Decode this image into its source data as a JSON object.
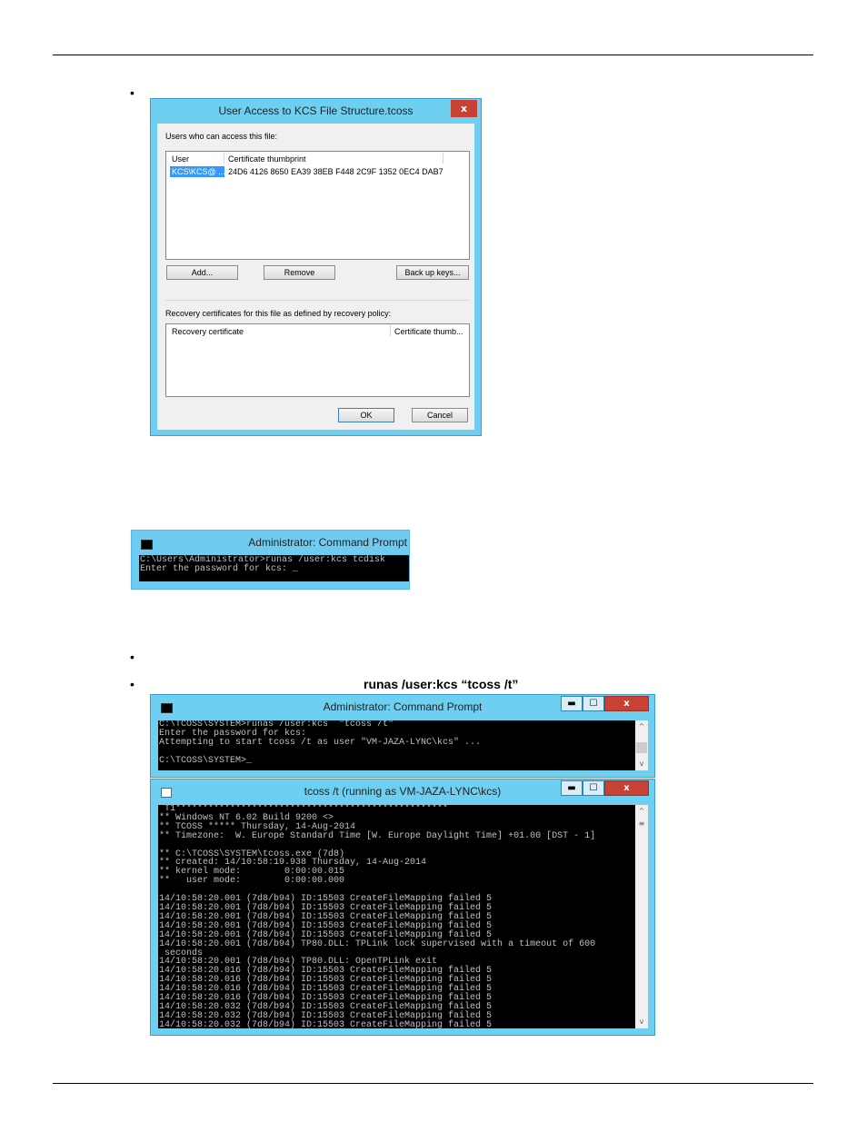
{
  "doc": {
    "bullets": [
      "•",
      "•",
      "•"
    ],
    "caption_bold": "runas /user:kcs “tcoss /t”"
  },
  "dialog": {
    "title": "User Access to KCS File Structure.tcoss",
    "close_glyph": "x",
    "users_label": "Users who can access this file:",
    "users_columns": [
      "User",
      "Certificate thumbprint"
    ],
    "users_rows": [
      {
        "user": "KCS\\KCS@ ...",
        "thumbprint": "24D6 4126 8650 EA39 38EB F448 2C9F 1352 0EC4 DAB7"
      }
    ],
    "buttons": {
      "add": "Add...",
      "remove": "Remove",
      "backup": "Back up keys...",
      "ok": "OK",
      "cancel": "Cancel"
    },
    "recovery_label": "Recovery certificates for this file as defined by recovery policy:",
    "recovery_columns": [
      "Recovery certificate",
      "Certificate thumb..."
    ]
  },
  "cmd_small": {
    "title": "Administrator: Command Prompt",
    "lines": "C:\\Users\\Administrator>runas /user:kcs tcdisk\nEnter the password for kcs: _"
  },
  "cmd_big": {
    "title": "Administrator: Command Prompt",
    "controls": {
      "min": "▬",
      "max": "☐",
      "close": "x"
    },
    "lines": "C:\\TCOSS\\SYSTEM>runas /user:kcs  \"tcoss /t\"\nEnter the password for kcs:\nAttempting to start tcoss /t as user \"VM-JAZA-LYNC\\kcs\" ...\n\nC:\\TCOSS\\SYSTEM>_"
  },
  "tcoss": {
    "title": "tcoss /t (running as VM-JAZA-LYNC\\kcs)",
    "controls": {
      "min": "▬",
      "max": "☐",
      "close": "x"
    },
    "lines": " T1**************************************************\n** Windows NT 6.02 Build 9200 <>\n** TCOSS ***** Thursday, 14-Aug-2014\n** Timezone:  W. Europe Standard Time [W. Europe Daylight Time] +01.00 [DST - 1]\n\n** C:\\TCOSS\\SYSTEM\\tcoss.exe (7d8)\n** created: 14/10:58:19.938 Thursday, 14-Aug-2014\n** kernel mode:        0:00:00.015\n**   user mode:        0:00:00.000\n\n14/10:58:20.001 (7d8/b94) ID:15503 CreateFileMapping failed 5\n14/10:58:20.001 (7d8/b94) ID:15503 CreateFileMapping failed 5\n14/10:58:20.001 (7d8/b94) ID:15503 CreateFileMapping failed 5\n14/10:58:20.001 (7d8/b94) ID:15503 CreateFileMapping failed 5\n14/10:58:20.001 (7d8/b94) ID:15503 CreateFileMapping failed 5\n14/10:58:20.001 (7d8/b94) TP80.DLL: TPLink lock supervised with a timeout of 600\n seconds\n14/10:58:20.001 (7d8/b94) TP80.DLL: OpenTPLink exit\n14/10:58:20.016 (7d8/b94) ID:15503 CreateFileMapping failed 5\n14/10:58:20.016 (7d8/b94) ID:15503 CreateFileMapping failed 5\n14/10:58:20.016 (7d8/b94) ID:15503 CreateFileMapping failed 5\n14/10:58:20.016 (7d8/b94) ID:15503 CreateFileMapping failed 5\n14/10:58:20.032 (7d8/b94) ID:15503 CreateFileMapping failed 5\n14/10:58:20.032 (7d8/b94) ID:15503 CreateFileMapping failed 5\n14/10:58:20.032 (7d8/b94) ID:15503 CreateFileMapping failed 5"
  },
  "scroll": {
    "up": "^",
    "down": "v",
    "grip": "≡"
  }
}
